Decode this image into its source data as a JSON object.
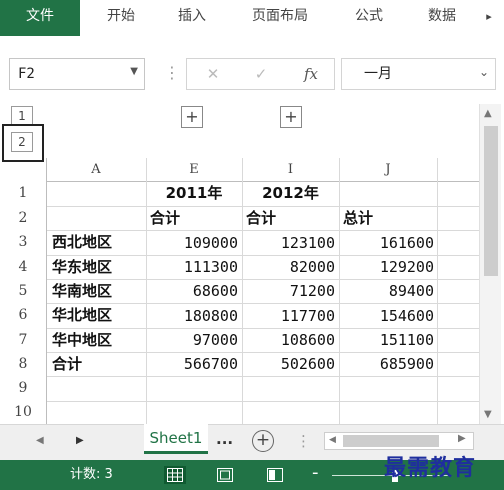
{
  "ribbon": {
    "tabs": [
      {
        "label": "文件",
        "active": true
      },
      {
        "label": "开始"
      },
      {
        "label": "插入"
      },
      {
        "label": "页面布局"
      },
      {
        "label": "公式"
      },
      {
        "label": "数据"
      }
    ],
    "more_icon": "caret-right-icon"
  },
  "formula_bar": {
    "name_box": "F2",
    "cancel_icon": "✕",
    "enter_icon": "✓",
    "fx_icon": "fx",
    "value": "一月"
  },
  "outline": {
    "level1": "1",
    "level2": "2",
    "expand_symbol": "+"
  },
  "grid": {
    "columns": [
      "A",
      "E",
      "I",
      "J"
    ],
    "rows": [
      "1",
      "2",
      "3",
      "4",
      "5",
      "6",
      "7",
      "8",
      "9",
      "10"
    ],
    "cells": {
      "r1": {
        "E": "2011年",
        "I": "2012年"
      },
      "r2": {
        "E": "合计",
        "I": "合计",
        "J": "总计"
      },
      "r3": {
        "A": "西北地区",
        "E": "109000",
        "I": "123100",
        "J": "161600"
      },
      "r4": {
        "A": "华东地区",
        "E": "111300",
        "I": "82000",
        "J": "129200"
      },
      "r5": {
        "A": "华南地区",
        "E": "68600",
        "I": "71200",
        "J": "89400"
      },
      "r6": {
        "A": "华北地区",
        "E": "180800",
        "I": "117700",
        "J": "154600"
      },
      "r7": {
        "A": "华中地区",
        "E": "97000",
        "I": "108600",
        "J": "151100"
      },
      "r8": {
        "A": "合计",
        "E": "566700",
        "I": "502600",
        "J": "685900"
      }
    }
  },
  "sheets": {
    "active": "Sheet1",
    "ellipsis": "...",
    "add_symbol": "+"
  },
  "status_bar": {
    "count_label": "计数: 3",
    "minus": "-"
  },
  "watermark": "最需教育",
  "colors": {
    "brand_green": "#217346",
    "watermark_blue": "#1f2e9e"
  }
}
